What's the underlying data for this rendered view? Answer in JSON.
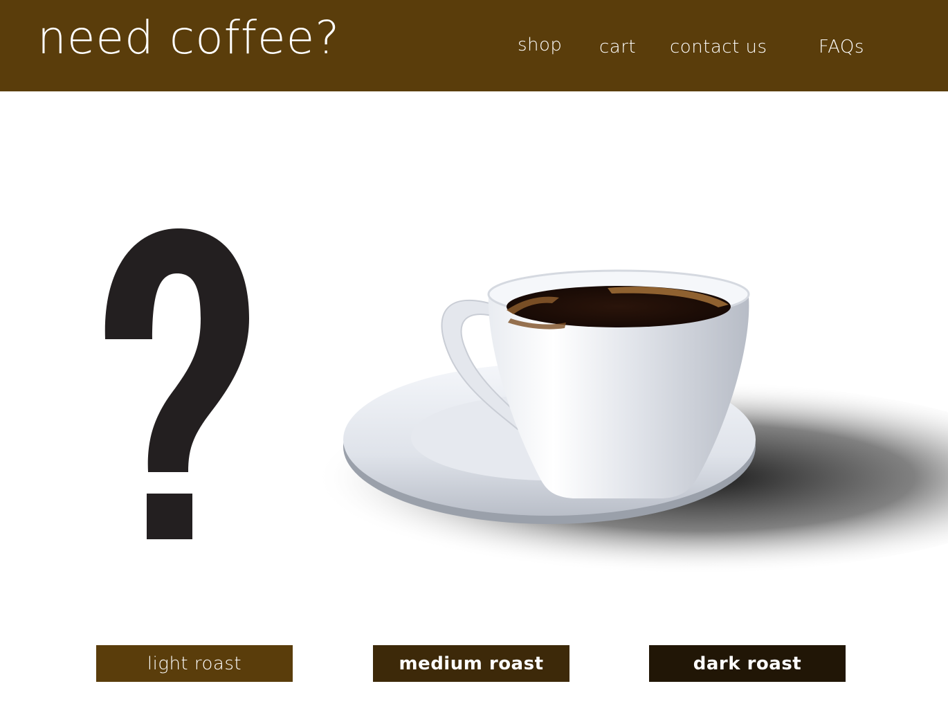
{
  "header": {
    "logo": "need coffee?",
    "nav": {
      "shop": "shop",
      "cart": "cart",
      "contact": "contact us",
      "faqs": "FAQs"
    }
  },
  "hero": {
    "question_glyph": "?",
    "image": "coffee-cup-on-saucer"
  },
  "roasts": {
    "light": "light roast",
    "medium": "medium roast",
    "dark": "dark roast"
  },
  "colors": {
    "header_bg": "#5a3d0b",
    "light_roast_bg": "#5a3d0b",
    "medium_roast_bg": "#3d2909",
    "dark_roast_bg": "#211606",
    "question_mark": "#231f20",
    "coffee": "#2a140a"
  }
}
